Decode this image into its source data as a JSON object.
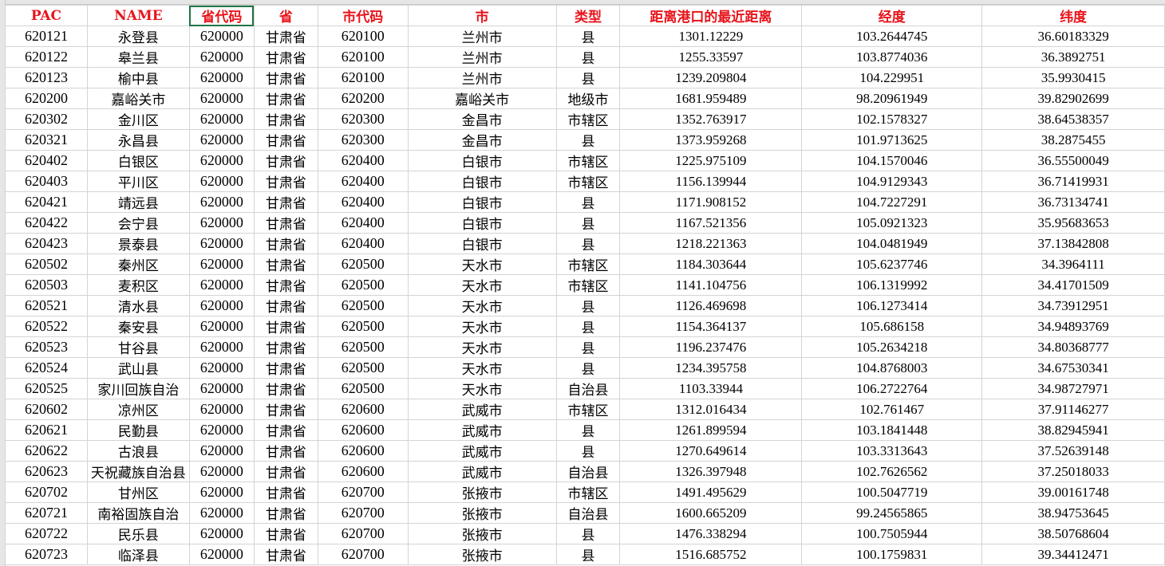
{
  "columns": [
    "PAC",
    "NAME",
    "省代码",
    "省",
    "市代码",
    "市",
    "类型",
    "距离港口的最近距离",
    "经度",
    "纬度"
  ],
  "rows": [
    [
      "620121",
      "永登县",
      "620000",
      "甘肃省",
      "620100",
      "兰州市",
      "县",
      "1301.12229",
      "103.2644745",
      "36.60183329"
    ],
    [
      "620122",
      "皋兰县",
      "620000",
      "甘肃省",
      "620100",
      "兰州市",
      "县",
      "1255.33597",
      "103.8774036",
      "36.3892751"
    ],
    [
      "620123",
      "榆中县",
      "620000",
      "甘肃省",
      "620100",
      "兰州市",
      "县",
      "1239.209804",
      "104.229951",
      "35.9930415"
    ],
    [
      "620200",
      "嘉峪关市",
      "620000",
      "甘肃省",
      "620200",
      "嘉峪关市",
      "地级市",
      "1681.959489",
      "98.20961949",
      "39.82902699"
    ],
    [
      "620302",
      "金川区",
      "620000",
      "甘肃省",
      "620300",
      "金昌市",
      "市辖区",
      "1352.763917",
      "102.1578327",
      "38.64538357"
    ],
    [
      "620321",
      "永昌县",
      "620000",
      "甘肃省",
      "620300",
      "金昌市",
      "县",
      "1373.959268",
      "101.9713625",
      "38.2875455"
    ],
    [
      "620402",
      "白银区",
      "620000",
      "甘肃省",
      "620400",
      "白银市",
      "市辖区",
      "1225.975109",
      "104.1570046",
      "36.55500049"
    ],
    [
      "620403",
      "平川区",
      "620000",
      "甘肃省",
      "620400",
      "白银市",
      "市辖区",
      "1156.139944",
      "104.9129343",
      "36.71419931"
    ],
    [
      "620421",
      "靖远县",
      "620000",
      "甘肃省",
      "620400",
      "白银市",
      "县",
      "1171.908152",
      "104.7227291",
      "36.73134741"
    ],
    [
      "620422",
      "会宁县",
      "620000",
      "甘肃省",
      "620400",
      "白银市",
      "县",
      "1167.521356",
      "105.0921323",
      "35.95683653"
    ],
    [
      "620423",
      "景泰县",
      "620000",
      "甘肃省",
      "620400",
      "白银市",
      "县",
      "1218.221363",
      "104.0481949",
      "37.13842808"
    ],
    [
      "620502",
      "秦州区",
      "620000",
      "甘肃省",
      "620500",
      "天水市",
      "市辖区",
      "1184.303644",
      "105.6237746",
      "34.3964111"
    ],
    [
      "620503",
      "麦积区",
      "620000",
      "甘肃省",
      "620500",
      "天水市",
      "市辖区",
      "1141.104756",
      "106.1319992",
      "34.41701509"
    ],
    [
      "620521",
      "清水县",
      "620000",
      "甘肃省",
      "620500",
      "天水市",
      "县",
      "1126.469698",
      "106.1273414",
      "34.73912951"
    ],
    [
      "620522",
      "秦安县",
      "620000",
      "甘肃省",
      "620500",
      "天水市",
      "县",
      "1154.364137",
      "105.686158",
      "34.94893769"
    ],
    [
      "620523",
      "甘谷县",
      "620000",
      "甘肃省",
      "620500",
      "天水市",
      "县",
      "1196.237476",
      "105.2634218",
      "34.80368777"
    ],
    [
      "620524",
      "武山县",
      "620000",
      "甘肃省",
      "620500",
      "天水市",
      "县",
      "1234.395758",
      "104.8768003",
      "34.67530341"
    ],
    [
      "620525",
      "家川回族自治",
      "620000",
      "甘肃省",
      "620500",
      "天水市",
      "自治县",
      "1103.33944",
      "106.2722764",
      "34.98727971"
    ],
    [
      "620602",
      "凉州区",
      "620000",
      "甘肃省",
      "620600",
      "武威市",
      "市辖区",
      "1312.016434",
      "102.761467",
      "37.91146277"
    ],
    [
      "620621",
      "民勤县",
      "620000",
      "甘肃省",
      "620600",
      "武威市",
      "县",
      "1261.899594",
      "103.1841448",
      "38.82945941"
    ],
    [
      "620622",
      "古浪县",
      "620000",
      "甘肃省",
      "620600",
      "武威市",
      "县",
      "1270.649614",
      "103.3313643",
      "37.52639148"
    ],
    [
      "620623",
      "天祝藏族自治县",
      "620000",
      "甘肃省",
      "620600",
      "武威市",
      "自治县",
      "1326.397948",
      "102.7626562",
      "37.25018033"
    ],
    [
      "620702",
      "甘州区",
      "620000",
      "甘肃省",
      "620700",
      "张掖市",
      "市辖区",
      "1491.495629",
      "100.5047719",
      "39.00161748"
    ],
    [
      "620721",
      "南裕固族自治",
      "620000",
      "甘肃省",
      "620700",
      "张掖市",
      "自治县",
      "1600.665209",
      "99.24565865",
      "38.94753645"
    ],
    [
      "620722",
      "民乐县",
      "620000",
      "甘肃省",
      "620700",
      "张掖市",
      "县",
      "1476.338294",
      "100.7505944",
      "38.50768604"
    ],
    [
      "620723",
      "临泽县",
      "620000",
      "甘肃省",
      "620700",
      "张掖市",
      "县",
      "1516.685752",
      "100.1759831",
      "39.34412471"
    ]
  ]
}
